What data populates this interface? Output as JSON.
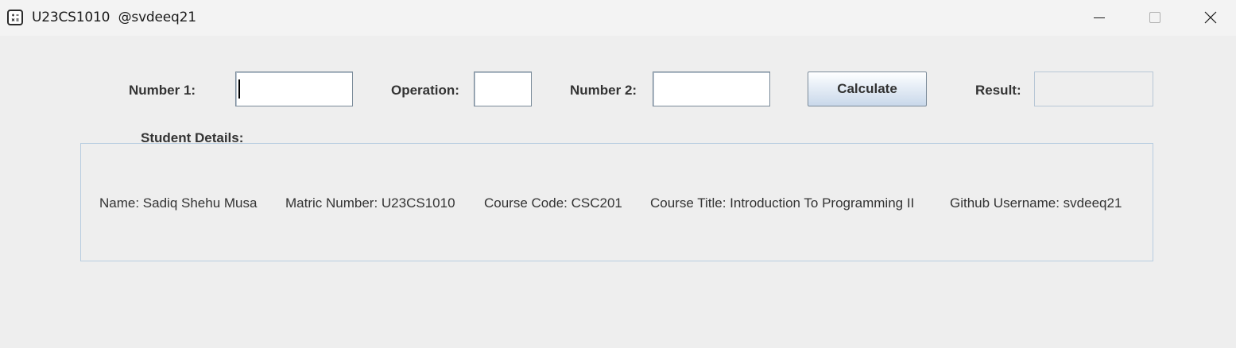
{
  "window": {
    "title": "U23CS1010  @svdeeq21",
    "icon": "calculator-icon",
    "controls": [
      "minimize-icon",
      "maximize-icon",
      "close-icon"
    ]
  },
  "form": {
    "number1_label": "Number 1:",
    "number1_value": "",
    "operation_label": "Operation:",
    "operation_value": "",
    "number2_label": "Number 2:",
    "number2_value": "",
    "calculate_label": "Calculate",
    "result_label": "Result:",
    "result_value": ""
  },
  "student_details": {
    "heading": "Student Details:",
    "name": "Name: Sadiq Shehu Musa",
    "matric": "Matric Number: U23CS1010",
    "course_code": "Course Code: CSC201",
    "course_title": "Course Title: Introduction To Programming II",
    "github": "Github Username: svdeeq21"
  },
  "colors": {
    "background": "#eeeeee",
    "titlebar": "#f3f3f3",
    "text": "#333333",
    "border": "#b8cde0"
  }
}
